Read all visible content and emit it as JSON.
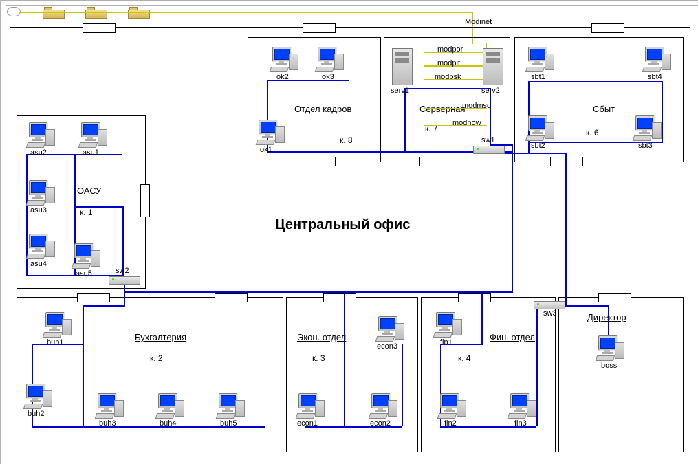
{
  "diagram_title": "Центральный офис",
  "external_label": "Modinet",
  "rooms": {
    "oasy": {
      "title": "ОАСУ",
      "num": "к. 1"
    },
    "hr": {
      "title": "Отдел кадров",
      "num": "к. 8"
    },
    "server": {
      "title": "Серверная",
      "num": "к. 7"
    },
    "sales": {
      "title": "Сбыт",
      "num": "к. 6"
    },
    "acct": {
      "title": "Бухгалтерия",
      "num": "к. 2"
    },
    "econ": {
      "title": "Экон. отдел",
      "num": "к. 3"
    },
    "fin": {
      "title": "Фин. отдел",
      "num": "к. 4"
    },
    "dir": {
      "title": "Директор",
      "num": ""
    }
  },
  "devices": {
    "asu1": "asu1",
    "asu2": "asu2",
    "asu3": "asu3",
    "asu4": "asu4",
    "asu5": "asu5",
    "ok1": "ok1",
    "ok2": "ok2",
    "ok3": "ok3",
    "serv1": "serv1",
    "serv2": "serv2",
    "sbt1": "sbt1",
    "sbt2": "sbt2",
    "sbt3": "sbt3",
    "sbt4": "sbt4",
    "buh1": "buh1",
    "buh2": "buh2",
    "buh3": "buh3",
    "buh4": "buh4",
    "buh5": "buh5",
    "econ1": "econ1",
    "econ2": "econ2",
    "econ3": "econ3",
    "fin1": "fin1",
    "fin2": "fin2",
    "fin3": "fin3",
    "boss": "boss",
    "sw1": "sw1",
    "sw2": "sw2",
    "sw3": "sw3"
  },
  "modems": {
    "modpor": "modpor",
    "modpit": "modpit",
    "modpsk": "modpsk",
    "modmsc": "modmsc",
    "modnow": "modnow"
  }
}
